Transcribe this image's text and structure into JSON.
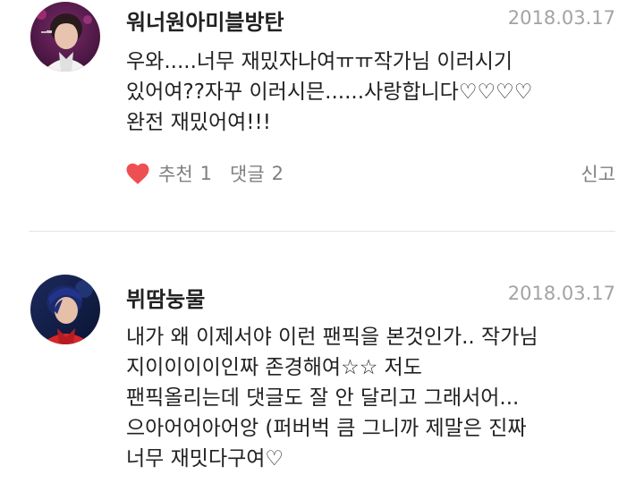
{
  "colors": {
    "like_heart": "#ee4f52",
    "meta_text": "#808080",
    "date_text": "#a3a3a3"
  },
  "comments": [
    {
      "username": "워너원아미블방탄",
      "date": "2018.03.17",
      "lines": [
        "우와.....너무 재밌자나여ㅠㅠ작가님 이러시기",
        "있어여??자꾸 이러시믄......사랑합니다♡♡♡♡",
        "완전 재밌어여!!!"
      ],
      "like_icon": "heart-icon",
      "like_label": "추천",
      "like_count": "1",
      "reply_label": "댓글",
      "reply_count": "2",
      "report_label": "신고"
    },
    {
      "username": "뷔땀눙물",
      "date": "2018.03.17",
      "lines": [
        "내가 왜 이제서야 이런 팬픽을 본것인가.. 작가님",
        "지이이이이인짜 존경해여☆☆ 저도",
        "팬픽올리는데 댓글도 잘 안 달리고 그래서어...",
        "으아어어아어앙 (퍼버벅 큼 그니까 제말은 진짜",
        "너무 재밋다구여♡"
      ]
    }
  ]
}
